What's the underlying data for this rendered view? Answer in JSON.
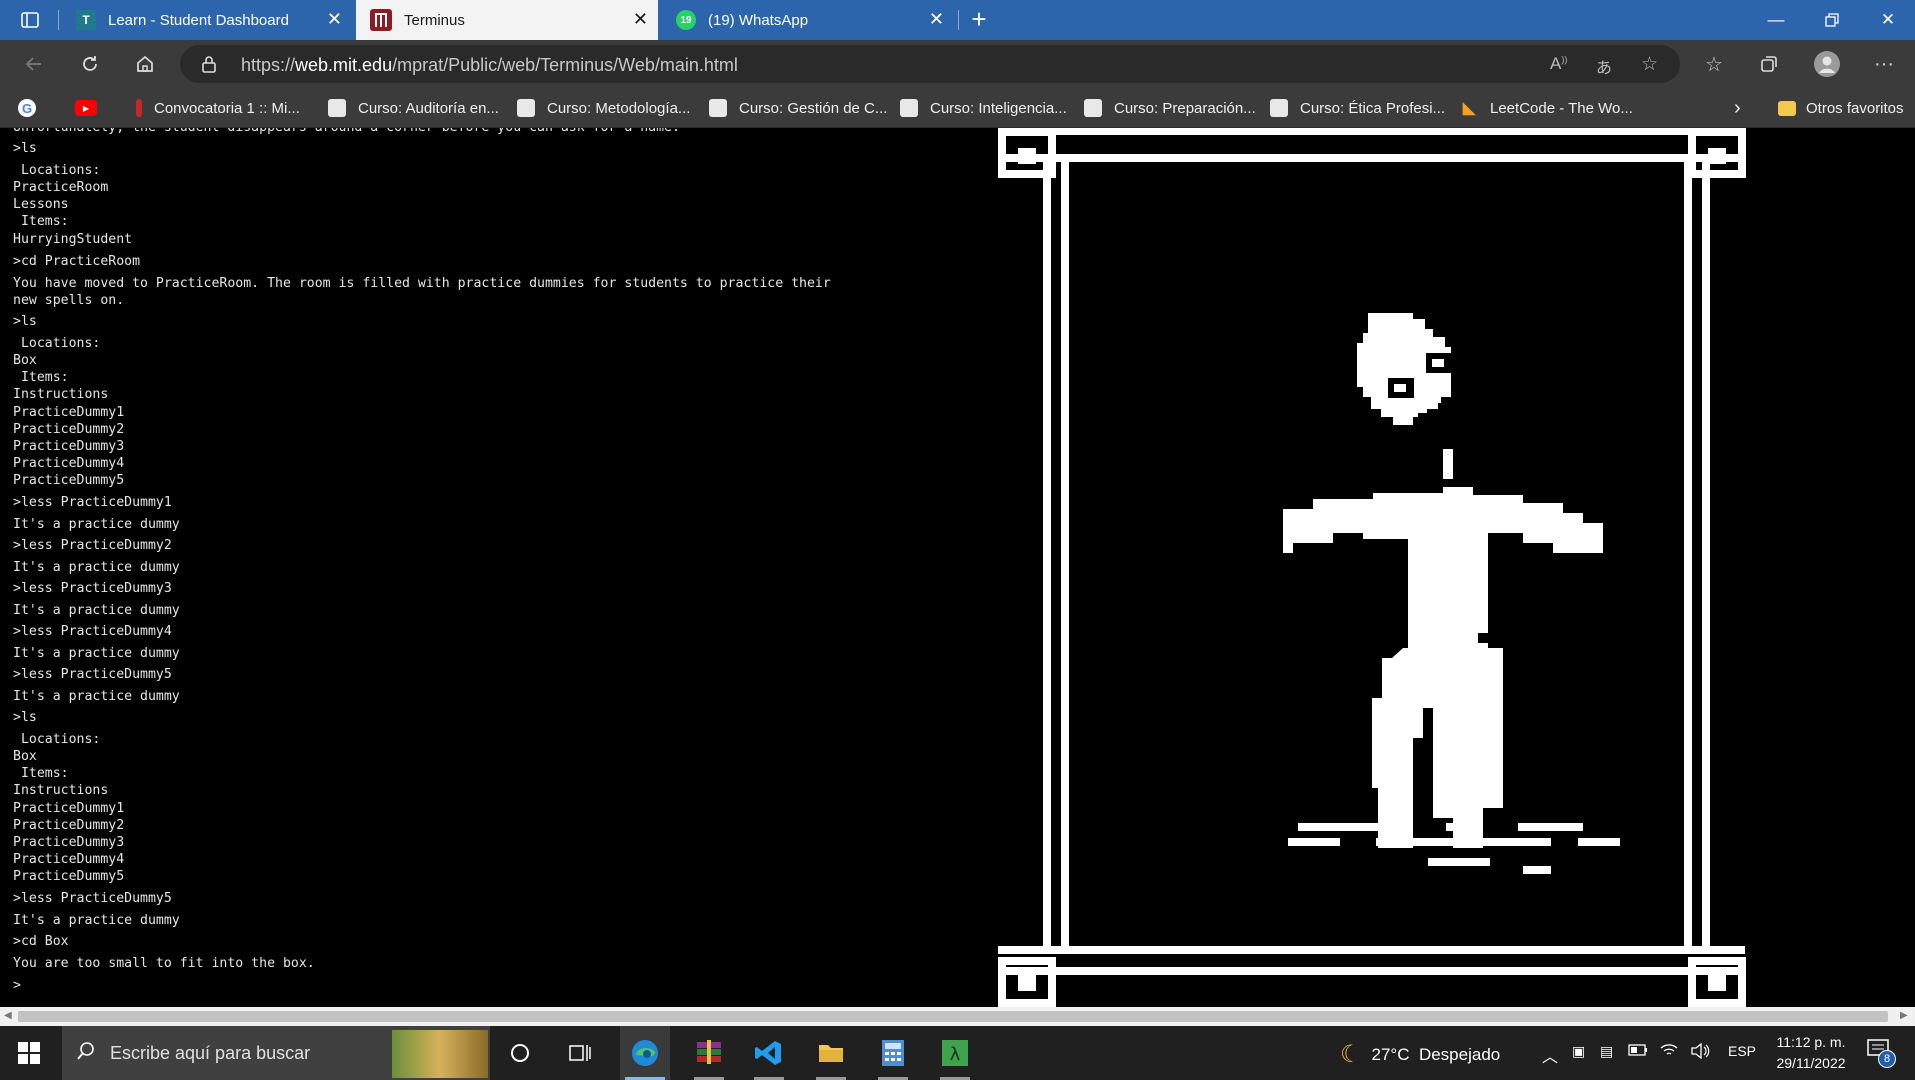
{
  "browser": {
    "tabs": [
      {
        "label": "Learn - Student Dashboard",
        "icon": "student-dashboard-icon"
      },
      {
        "label": "Terminus",
        "icon": "terminus-icon"
      },
      {
        "label": "(19) WhatsApp",
        "icon": "whatsapp-icon",
        "badge": "19"
      }
    ],
    "new_tab_label": "+",
    "address_bar": {
      "url_prefix": "https://",
      "url_host": "web.mit.edu",
      "url_path": "/mprat/Public/web/Terminus/Web/main.html"
    },
    "favorites": [
      {
        "label": "",
        "icon": "google-icon"
      },
      {
        "label": "",
        "icon": "youtube-icon"
      },
      {
        "label": "Convocatoria 1 :: Mi...",
        "icon": "page-icon"
      },
      {
        "label": "Curso: Auditoría en...",
        "icon": "course-icon"
      },
      {
        "label": "Curso: Metodología...",
        "icon": "course-icon"
      },
      {
        "label": "Curso: Gestión de C...",
        "icon": "course-icon"
      },
      {
        "label": "Curso: Inteligencia...",
        "icon": "course-icon"
      },
      {
        "label": "Curso: Preparación...",
        "icon": "course-icon"
      },
      {
        "label": "Curso: Ética Profesi...",
        "icon": "course-icon"
      },
      {
        "label": "LeetCode - The Wo...",
        "icon": "leetcode-icon"
      }
    ],
    "other_favorites": "Otros favoritos"
  },
  "terminal": {
    "lines": [
      "Unfortunately, the student disappears around a corner before you can ask for a name.",
      ">ls",
      " Locations:",
      "PracticeRoom",
      "Lessons",
      " Items:",
      "HurryingStudent",
      ">cd PracticeRoom",
      "You have moved to PracticeRoom. The room is filled with practice dummies for students to practice their",
      "new spells on.",
      ">ls",
      " Locations:",
      "Box",
      " Items:",
      "Instructions",
      "PracticeDummy1",
      "PracticeDummy2",
      "PracticeDummy3",
      "PracticeDummy4",
      "PracticeDummy5",
      ">less PracticeDummy1",
      "It's a practice dummy",
      ">less PracticeDummy2",
      "It's a practice dummy",
      ">less PracticeDummy3",
      "It's a practice dummy",
      ">less PracticeDummy4",
      "It's a practice dummy",
      ">less PracticeDummy5",
      "It's a practice dummy",
      ">ls",
      " Locations:",
      "Box",
      " Items:",
      "Instructions",
      "PracticeDummy1",
      "PracticeDummy2",
      "PracticeDummy3",
      "PracticeDummy4",
      "PracticeDummy5",
      ">less PracticeDummy5",
      "It's a practice dummy",
      ">cd Box",
      "You are too small to fit into the box.",
      ">"
    ]
  },
  "taskbar": {
    "search_placeholder": "Escribe aquí para buscar",
    "weather": "27°C  Despejado",
    "language": "ESP",
    "time": "11:12 p. m.",
    "date": "29/11/2022",
    "notifications": "8"
  },
  "colors": {
    "tabbar": "#2d65ad",
    "toolbar": "#3b3b3b",
    "taskbar": "#202020",
    "terminal_bg": "#000000"
  }
}
